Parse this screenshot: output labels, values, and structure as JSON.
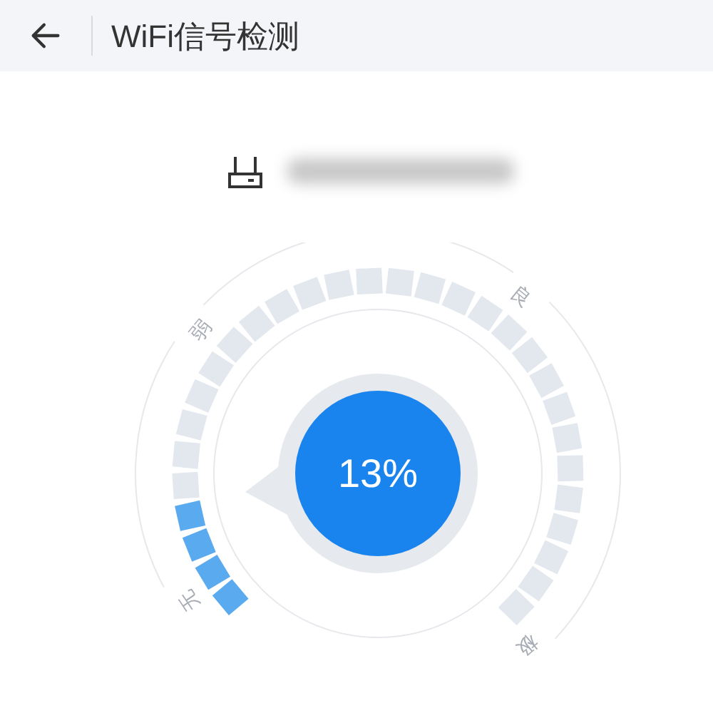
{
  "header": {
    "title": "WiFi信号检测"
  },
  "signal": {
    "reading": "13%",
    "labels": [
      "无",
      "弱",
      "良",
      "极"
    ],
    "segments": [
      {
        "on": true
      },
      {
        "on": true
      },
      {
        "on": true
      },
      {
        "on": true
      },
      {
        "on": false
      },
      {
        "on": false
      },
      {
        "on": false
      },
      {
        "on": false
      },
      {
        "on": false
      },
      {
        "on": false
      },
      {
        "on": false
      },
      {
        "on": false
      },
      {
        "on": false
      },
      {
        "on": false
      },
      {
        "on": false
      },
      {
        "on": false
      },
      {
        "on": false
      },
      {
        "on": false
      },
      {
        "on": false
      },
      {
        "on": false
      },
      {
        "on": false
      },
      {
        "on": false
      },
      {
        "on": false
      },
      {
        "on": false
      },
      {
        "on": false
      },
      {
        "on": false
      },
      {
        "on": false
      },
      {
        "on": false
      },
      {
        "on": false
      },
      {
        "on": false
      }
    ]
  }
}
